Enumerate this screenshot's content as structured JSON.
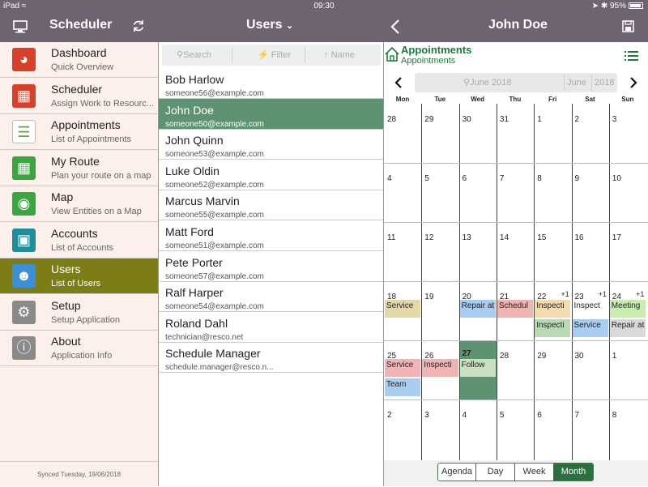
{
  "status_bar": {
    "carrier": "iPad",
    "time": "09:30",
    "battery": "95%"
  },
  "sidebar_header": {
    "title": "Scheduler"
  },
  "users_header": {
    "title": "Users"
  },
  "detail_header": {
    "title": "John Doe"
  },
  "sidebar": {
    "items": [
      {
        "label": "Dashboard",
        "sub": "Quick Overview",
        "icon": "dashboard-icon",
        "color": "#d9402b"
      },
      {
        "label": "Scheduler",
        "sub": "Assign Work to Resourc...",
        "icon": "scheduler-icon",
        "color": "#d9402b"
      },
      {
        "label": "Appointments",
        "sub": "List of Appointments",
        "icon": "appointments-icon",
        "color": "#ffffff"
      },
      {
        "label": "My Route",
        "sub": "Plan your route on a map",
        "icon": "route-icon",
        "color": "#3aa640"
      },
      {
        "label": "Map",
        "sub": "View Entities on a Map",
        "icon": "map-pin-icon",
        "color": "#3aa640"
      },
      {
        "label": "Accounts",
        "sub": "List of Accounts",
        "icon": "accounts-icon",
        "color": "#1e8f9a"
      },
      {
        "label": "Users",
        "sub": "List of Users",
        "icon": "users-icon",
        "color": "#3b8ed8"
      },
      {
        "label": "Setup",
        "sub": "Setup Application",
        "icon": "gear-icon",
        "color": "#8a8a8a"
      },
      {
        "label": "About",
        "sub": "Application Info",
        "icon": "info-icon",
        "color": "#8a8a8a"
      }
    ],
    "selected_index": 6,
    "sync_text": "Synced Tuesday, 19/06/2018"
  },
  "users_toolbar": {
    "search": "Search",
    "filter": "Filter",
    "sort": "Name"
  },
  "users": [
    {
      "name": "Bob Harlow",
      "email": "someone56@example.com"
    },
    {
      "name": "John Doe",
      "email": "someone50@example.com"
    },
    {
      "name": "John Quinn",
      "email": "someone53@example.com"
    },
    {
      "name": "Luke Oldin",
      "email": "someone52@example.com"
    },
    {
      "name": "Marcus Marvin",
      "email": "someone55@example.com"
    },
    {
      "name": "Matt Ford",
      "email": "someone51@example.com"
    },
    {
      "name": "Pete Porter",
      "email": "someone57@example.com"
    },
    {
      "name": "Ralf Harper",
      "email": "someone54@example.com"
    },
    {
      "name": "Roland Dahl",
      "email": "technician@resco.net"
    },
    {
      "name": "Schedule Manager",
      "email": "schedule.manager@resco.n..."
    }
  ],
  "users_selected_index": 1,
  "calendar": {
    "title": "Appointments",
    "subtitle": "Appointments",
    "search_text": "June 2018",
    "month": "June",
    "year": "2018",
    "weekdays": [
      "Mon",
      "Tue",
      "Wed",
      "Thu",
      "Fri",
      "Sat",
      "Sun"
    ],
    "weeks": [
      [
        "28",
        "29",
        "30",
        "31",
        "1",
        "2",
        "3"
      ],
      [
        "4",
        "5",
        "6",
        "7",
        "8",
        "9",
        "10"
      ],
      [
        "11",
        "12",
        "13",
        "14",
        "15",
        "16",
        "17"
      ],
      [
        "18",
        "19",
        "20",
        "21",
        "22",
        "23",
        "24"
      ],
      [
        "25",
        "26",
        "27",
        "28",
        "29",
        "30",
        "1"
      ],
      [
        "2",
        "3",
        "4",
        "5",
        "6",
        "7",
        "8"
      ]
    ],
    "today": {
      "week": 4,
      "day": 2
    },
    "more": [
      {
        "week": 3,
        "day": 4,
        "text": "+1"
      },
      {
        "week": 3,
        "day": 5,
        "text": "+1"
      },
      {
        "week": 3,
        "day": 6,
        "text": "+1"
      }
    ],
    "events": [
      {
        "week": 3,
        "day": 0,
        "slot": 0,
        "text": "Service",
        "color": "#e3d9a8"
      },
      {
        "week": 3,
        "day": 2,
        "slot": 0,
        "text": "Repair at",
        "color": "#a9cdf0"
      },
      {
        "week": 3,
        "day": 3,
        "slot": 0,
        "text": "Schedul",
        "color": "#f2b3b3"
      },
      {
        "week": 3,
        "day": 4,
        "slot": 0,
        "text": "Inspecti",
        "color": "#f5dcb0"
      },
      {
        "week": 3,
        "day": 4,
        "slot": 1,
        "text": "Inspecti",
        "color": "#b9d9b5"
      },
      {
        "week": 3,
        "day": 5,
        "slot": 0,
        "text": "Inspect",
        "color": "#ffffff"
      },
      {
        "week": 3,
        "day": 5,
        "slot": 1,
        "text": "Service",
        "color": "#a9cdf0"
      },
      {
        "week": 3,
        "day": 6,
        "slot": 0,
        "text": "Meeting",
        "color": "#c9ecb0"
      },
      {
        "week": 3,
        "day": 6,
        "slot": 1,
        "text": "Repair at",
        "color": "#d9d9d9"
      },
      {
        "week": 4,
        "day": 0,
        "slot": 0,
        "text": "Service",
        "color": "#f2b3b3"
      },
      {
        "week": 4,
        "day": 0,
        "slot": 1,
        "text": "Team",
        "color": "#a9cdf0"
      },
      {
        "week": 4,
        "day": 1,
        "slot": 0,
        "text": "Inspecti",
        "color": "#f2b3b3"
      },
      {
        "week": 4,
        "day": 2,
        "slot": 0,
        "text": "Follow",
        "color": "#c8e0c0"
      }
    ],
    "view_tabs": [
      "Agenda",
      "Day",
      "Week",
      "Month"
    ],
    "active_view": 3
  },
  "colors": {
    "header": "#6e6370",
    "accent_green": "#1d7a3d",
    "selection": "#5d9371",
    "sidebar_selected": "#7d7d17"
  }
}
